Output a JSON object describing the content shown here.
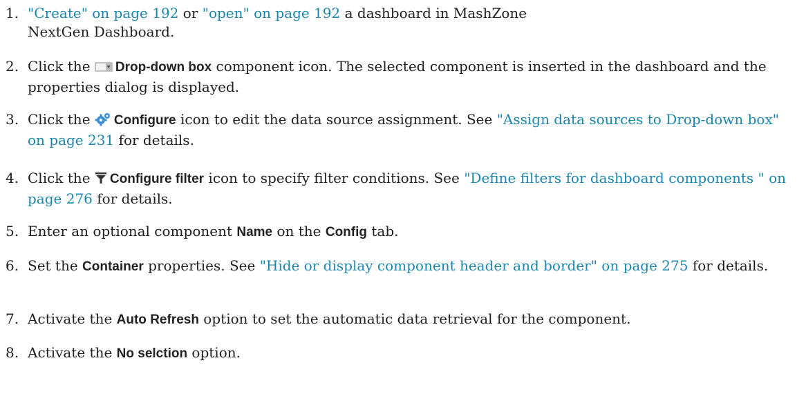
{
  "steps": [
    {
      "num": "1.",
      "link1": "\"Create\" on page 192",
      "t1": " or ",
      "link2": "\"open\" on page 192",
      "t2": " a dashboard in MashZone",
      "t3": "NextGen Dashboard."
    },
    {
      "num": "2.",
      "t1": "Click the ",
      "icon": "dropdown-box-icon",
      "ui": "Drop-down box",
      "t2": " component icon. The selected component is inserted in the dashboard and the properties dialog is displayed."
    },
    {
      "num": "3.",
      "t1": "Click the ",
      "icon": "gears-icon",
      "ui": "Configure",
      "t2": " icon to edit the data source assignment. See ",
      "link1": "\"Assign data sources to Drop-down box\" on page 231",
      "t3": " for details."
    },
    {
      "num": "4.",
      "t1": "Click the ",
      "icon": "filter-icon",
      "ui": "Configure filter",
      "t2": " icon to specify filter conditions. See ",
      "link1": "\"Define filters for dashboard components \" on page 276",
      "t3": " for details."
    },
    {
      "num": "5.",
      "t1": "Enter an optional component ",
      "ui1": "Name",
      "t2": " on the ",
      "ui2": "Config",
      "t3": " tab."
    },
    {
      "num": "6.",
      "t1": "Set the ",
      "ui": "Container",
      "t2": " properties. See ",
      "link1": "\"Hide or display component header and border\" on page 275",
      "t3": " for details."
    },
    {
      "num": "7.",
      "t1": "Activate the ",
      "ui": "Auto Refresh",
      "t2": " option to set the automatic data retrieval for the component."
    },
    {
      "num": "8.",
      "t1": "Activate the ",
      "ui": "No selction",
      "t2": " option."
    }
  ],
  "colors": {
    "link": "#1a86b0",
    "text": "#1f1f1f"
  }
}
